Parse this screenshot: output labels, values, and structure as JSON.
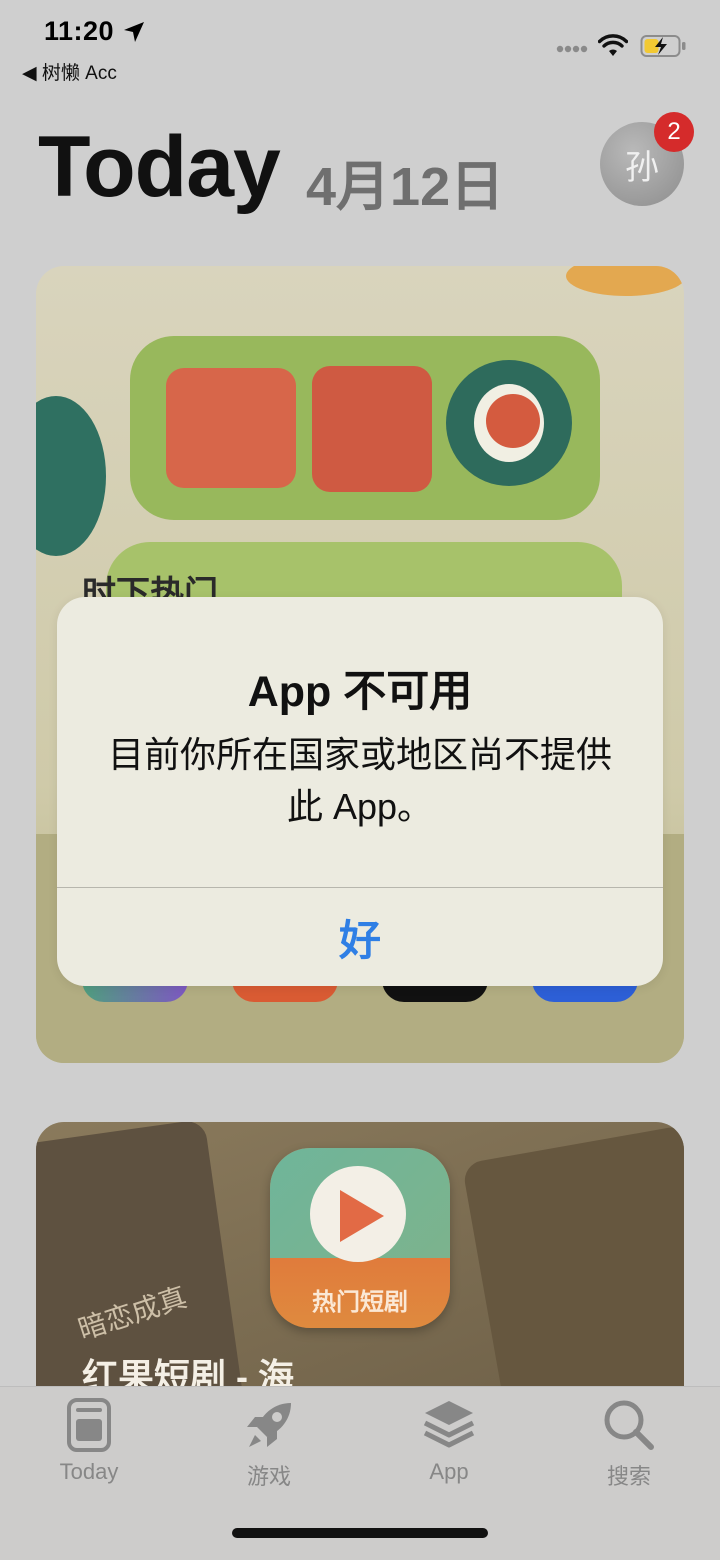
{
  "status_bar": {
    "time": "11:20",
    "back_app": "◀ 树懒 Acc"
  },
  "header": {
    "title": "Today",
    "date": "4月12日",
    "avatar_text": "孙",
    "badge_count": "2"
  },
  "card1": {
    "hot_text": "时下热门"
  },
  "alert": {
    "title": "App 不可用",
    "message": "目前你所在国家或地区尚不提供此 App。",
    "ok_label": "好"
  },
  "card2": {
    "app_label": "热门短剧",
    "title": "红果短剧 - 海",
    "poster_text": "暗恋成真"
  },
  "tabbar": {
    "items": [
      {
        "label": "Today",
        "icon": "today-icon"
      },
      {
        "label": "游戏",
        "icon": "rocket-icon"
      },
      {
        "label": "App",
        "icon": "layers-icon"
      },
      {
        "label": "搜索",
        "icon": "search-icon"
      }
    ]
  },
  "colors": {
    "accent": "#2f7fe5",
    "badge": "#d52b2b"
  }
}
